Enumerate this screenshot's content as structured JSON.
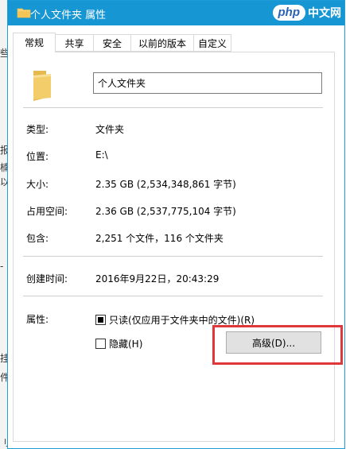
{
  "background_fragments": [
    "些",
    "报",
    "楠",
    "以",
    "-",
    "挂",
    "件",
    "刂"
  ],
  "window": {
    "title": "个人文件夹 属性",
    "watermark": {
      "badge": "php",
      "text": "中文网"
    }
  },
  "tabs": [
    {
      "label": "常规",
      "active": true
    },
    {
      "label": "共享",
      "active": false
    },
    {
      "label": "安全",
      "active": false
    },
    {
      "label": "以前的版本",
      "active": false
    },
    {
      "label": "自定义",
      "active": false
    }
  ],
  "general": {
    "folder_name": "个人文件夹",
    "type": {
      "label": "类型:",
      "value": "文件夹"
    },
    "location": {
      "label": "位置:",
      "value": "E:\\"
    },
    "size": {
      "label": "大小:",
      "value": "2.35 GB (2,534,348,861 字节)"
    },
    "size_on_disk": {
      "label": "占用空间:",
      "value": "2.36 GB (2,537,775,104 字节)"
    },
    "contains": {
      "label": "包含:",
      "value": "2,251 个文件，116 个文件夹"
    },
    "created": {
      "label": "创建时间:",
      "value": "2016年9月22日，20:43:29"
    },
    "attributes": {
      "label": "属性:",
      "readonly": {
        "label": "只读(仅应用于文件夹中的文件)(R)",
        "state": "indeterminate"
      },
      "hidden": {
        "label": "隐藏(H)",
        "state": "unchecked"
      },
      "advanced_button": "高级(D)..."
    }
  },
  "colors": {
    "titlebar": "#1796d4",
    "highlight": "#e0383a",
    "folder": "#f2cd6a"
  }
}
